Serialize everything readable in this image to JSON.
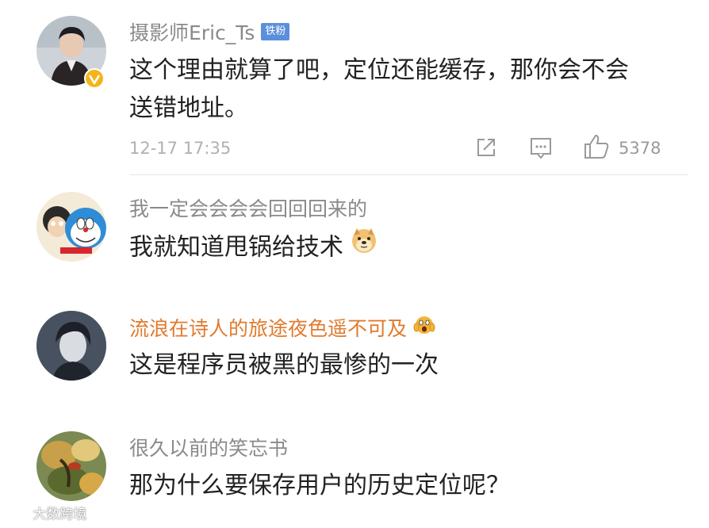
{
  "comments": [
    {
      "username": "摄影师Eric_Ts",
      "badge": "铁粉",
      "text_line1": "这个理由就算了吧，定位还能缓存，那你会不会",
      "text_line2": "送错地址。",
      "time": "12-17 17:35",
      "likes": "5378",
      "avatar_icon": "user-avatar-photo",
      "verified_icon": "verified-v-icon"
    },
    {
      "username": "我一定会会会会回回回来的",
      "text": "我就知道甩锅给技术",
      "emoji_icon": "doge-emoji-icon"
    },
    {
      "username": "流浪在诗人的旅途夜色遥不可及",
      "text": "这是程序员被黑的最惨的一次",
      "emoji_icon": "scared-face-emoji-icon",
      "username_color": "#e07a2e"
    },
    {
      "username": "很久以前的笑忘书",
      "text": "那为什么要保存用户的历史定位呢？"
    }
  ],
  "watermark": "大数跨境",
  "colors": {
    "username": "#8a8a8a",
    "text": "#222222",
    "meta": "#b0b0b0",
    "badge": "#5b8fdc",
    "verified": "#f5b41c"
  }
}
